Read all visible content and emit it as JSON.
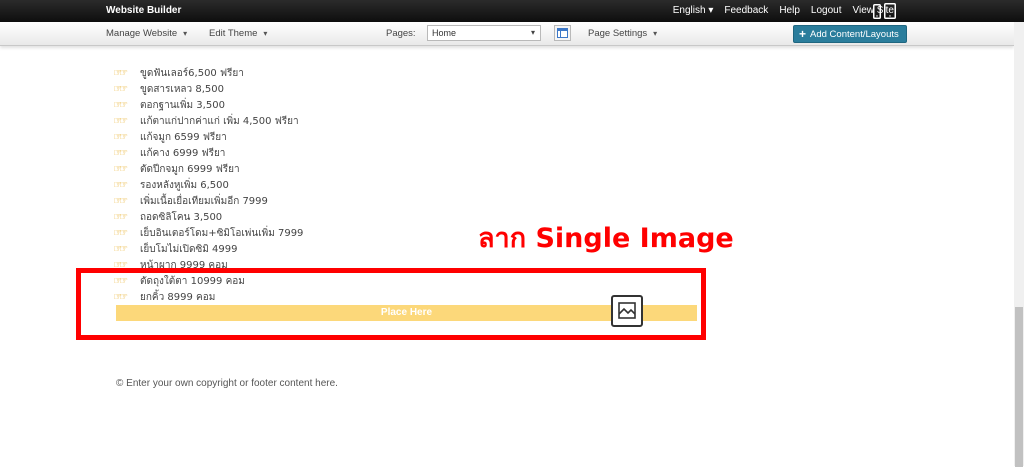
{
  "topbar": {
    "brand": "Website Builder",
    "links": [
      "English",
      "Feedback",
      "Help",
      "Logout",
      "View Site"
    ],
    "english_caret": "▾"
  },
  "toolbar": {
    "manage_website": "Manage Website",
    "edit_theme": "Edit Theme",
    "pages_label": "Pages:",
    "pages_selected": "Home",
    "page_settings": "Page Settings",
    "add_content": "Add Content/Layouts"
  },
  "content": {
    "items": [
      "ขูดฟันเลอร์6,500 ฟรียา",
      "ขูดสารเหลว 8,500",
      "ตอกฐานเพิ่ม 3,500",
      "แก้ตาแก่ปากค่าแก่ เพิ่ม 4,500 ฟรียา",
      "แก้จมูก 6599 ฟรียา",
      "แก้คาง  6999  ฟรียา",
      "ตัดปีกจมูก 6999 ฟรียา",
      "รองหลังหูเพิ่ม 6,500",
      "เพิ่มเนื้อเยื่อเทียมเพิ่มอีก 7999",
      "ถอดซิลิโคน 3,500",
      "เย็บอินเตอร์โดม+ซิมิโอเพ่นเพิ่ม 7999",
      "เย็บโมไม่เปิดซิมิ  4999",
      "หน้าผาก  9999 คอม",
      "ตัดถุงใต้ตา 10999  คอม",
      "ยกคิ้ว  8999 คอม"
    ],
    "place_here": "Place Here",
    "annotation": "ลาก Single Image"
  },
  "footer": {
    "copyright": "© Enter your own copyright or footer content here."
  },
  "colors": {
    "annotation_red": "#ff0000",
    "drop_zone": "#fcd87a",
    "add_button": "#2a7d9c"
  }
}
